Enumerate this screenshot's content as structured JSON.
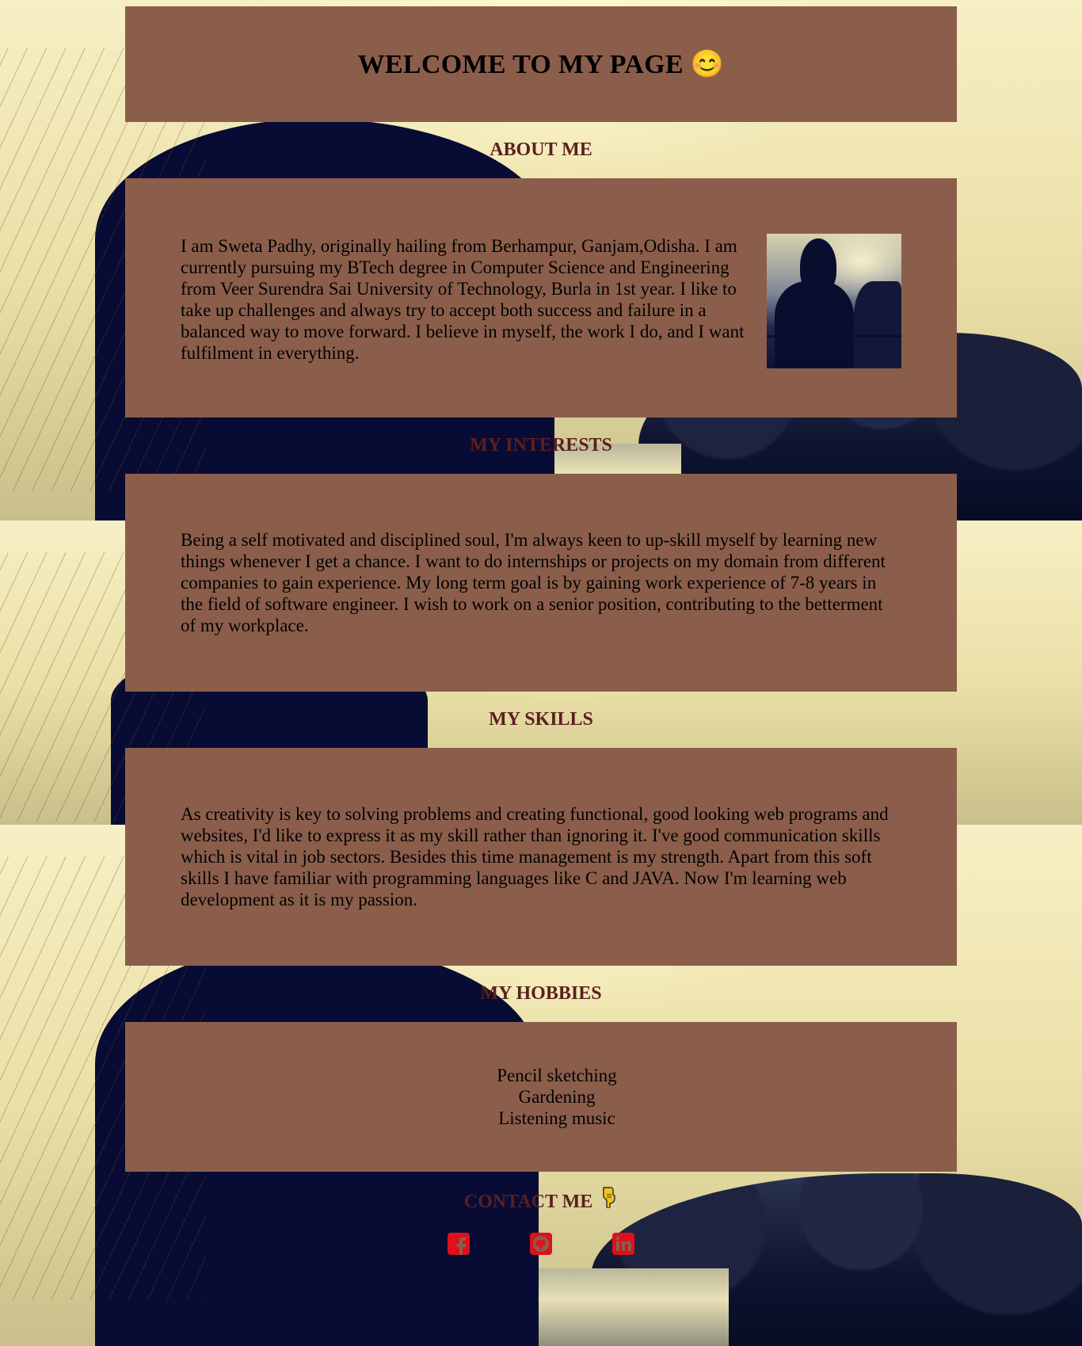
{
  "page": {
    "title": "WELCOME TO MY PAGE",
    "title_emoji": "😊"
  },
  "about": {
    "heading": "ABOUT ME",
    "text": "I am Sweta Padhy, originally hailing from Berhampur, Ganjam,Odisha. I am currently pursuing my BTech degree in Computer Science and Engineering from Veer Surendra Sai University of Technology, Burla in 1st year. I like to take up challenges and always try to accept both success and failure in a balanced way to move forward. I believe in myself, the work I do, and I want fulfilment in everything.",
    "photo_icon": "profile-photo-silhouette"
  },
  "interests": {
    "heading": "MY INTERESTS",
    "text": "Being a self motivated and disciplined soul, I'm always keen to up-skill myself by learning new things whenever I get a chance. I want to do internships or projects on my domain from different companies to gain experience. My long term goal is by gaining work experience of 7-8 years in the field of software engineer. I wish to work on a senior position, contributing to the betterment of my workplace."
  },
  "skills": {
    "heading": "MY SKILLS",
    "text": "As creativity is key to solving problems and creating functional, good looking web programs and websites, I'd like to express it as my skill rather than ignoring it. I've good communication skills which is vital in job sectors. Besides this time management is my strength. Apart from this soft skills I have familiar with programming languages like C and JAVA. Now I'm learning web development as it is my passion."
  },
  "hobbies": {
    "heading": "MY HOBBIES",
    "items": [
      "Pencil sketching",
      "Gardening",
      "Listening music"
    ]
  },
  "contact": {
    "heading": "CONTACT ME",
    "pointer_icon": "pointing-down-hand-icon",
    "links": [
      {
        "icon": "facebook-icon"
      },
      {
        "icon": "github-icon"
      },
      {
        "icon": "linkedin-icon"
      }
    ]
  },
  "colors": {
    "panel": "#8b5e4b",
    "heading": "#5a1f1f",
    "social": "#e0101a"
  }
}
